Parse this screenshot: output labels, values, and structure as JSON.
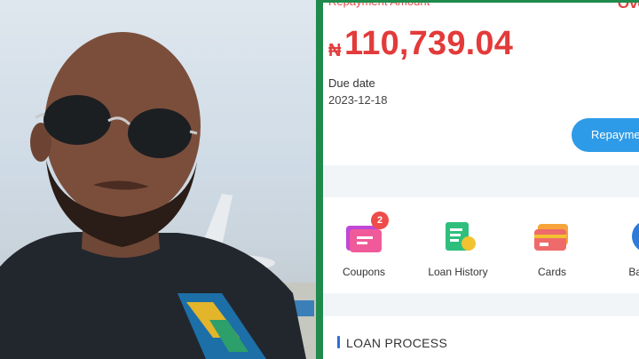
{
  "repayment": {
    "label": "Repayment Amount",
    "status": "Ove",
    "currency_symbol": "₦",
    "amount": "110,739.04",
    "due_label": "Due date",
    "due_date": "2023-12-18",
    "button_label": "Repayme"
  },
  "menu": {
    "items": [
      {
        "label": "Coupons",
        "icon": "coupon-icon",
        "badge": "2"
      },
      {
        "label": "Loan History",
        "icon": "loan-history-icon"
      },
      {
        "label": "Cards",
        "icon": "cards-icon"
      },
      {
        "label": "Bank",
        "icon": "bank-icon"
      }
    ]
  },
  "section": {
    "title": "LOAN PROCESS"
  },
  "colors": {
    "amount_red": "#e33a3a",
    "button_blue": "#2e9be8",
    "divider_green": "#1f8a4c"
  }
}
